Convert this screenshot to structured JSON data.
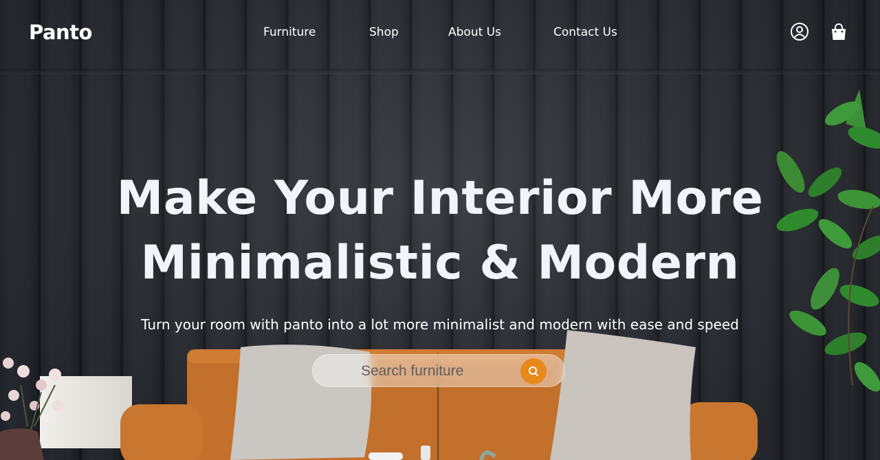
{
  "brand": {
    "logo": "Panto"
  },
  "nav": {
    "links": [
      "Furniture",
      "Shop",
      "About Us",
      "Contact Us"
    ],
    "icons": [
      "user-icon",
      "shopping-bag-icon"
    ]
  },
  "hero": {
    "headline_line1": "Make Your Interior More",
    "headline_line2": "Minimalistic & Modern",
    "subtext": "Turn your room with panto into a lot more minimalist and modern with ease and speed"
  },
  "search": {
    "placeholder": "Search furniture",
    "value": "",
    "button_icon": "search-icon"
  },
  "colors": {
    "accent": "#e78a1d",
    "wall": "#2b2e34",
    "sofa": "#c8742e",
    "text": "#ffffff"
  }
}
